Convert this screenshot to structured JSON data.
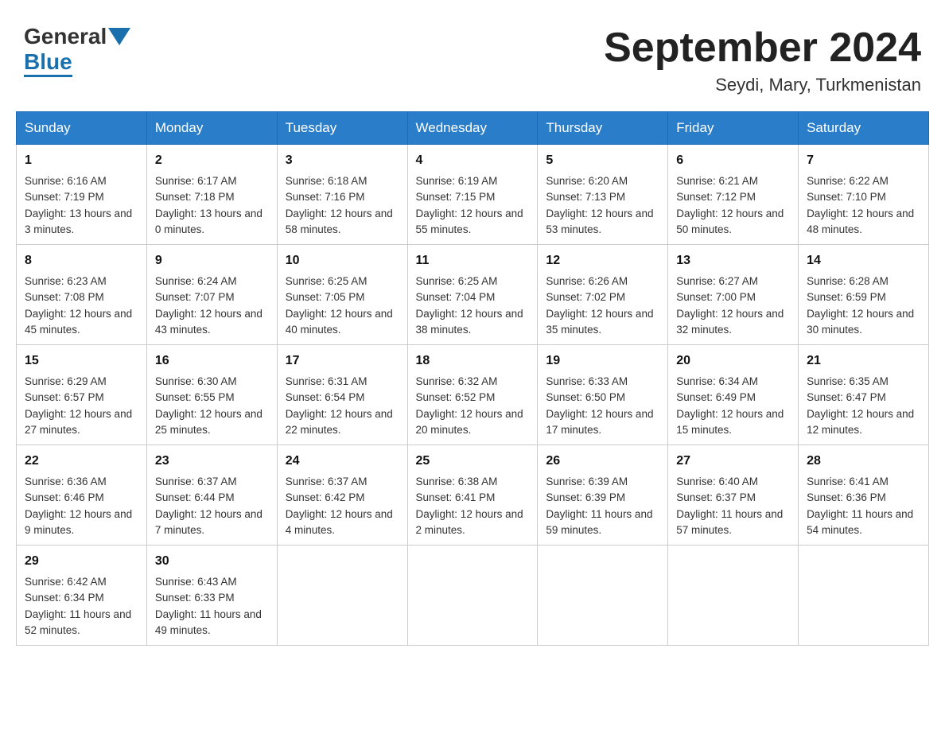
{
  "header": {
    "logo_text_general": "General",
    "logo_text_blue": "Blue",
    "title": "September 2024",
    "subtitle": "Seydi, Mary, Turkmenistan"
  },
  "weekdays": [
    "Sunday",
    "Monday",
    "Tuesday",
    "Wednesday",
    "Thursday",
    "Friday",
    "Saturday"
  ],
  "weeks": [
    [
      {
        "day": "1",
        "sunrise": "6:16 AM",
        "sunset": "7:19 PM",
        "daylight": "13 hours and 3 minutes."
      },
      {
        "day": "2",
        "sunrise": "6:17 AM",
        "sunset": "7:18 PM",
        "daylight": "13 hours and 0 minutes."
      },
      {
        "day": "3",
        "sunrise": "6:18 AM",
        "sunset": "7:16 PM",
        "daylight": "12 hours and 58 minutes."
      },
      {
        "day": "4",
        "sunrise": "6:19 AM",
        "sunset": "7:15 PM",
        "daylight": "12 hours and 55 minutes."
      },
      {
        "day": "5",
        "sunrise": "6:20 AM",
        "sunset": "7:13 PM",
        "daylight": "12 hours and 53 minutes."
      },
      {
        "day": "6",
        "sunrise": "6:21 AM",
        "sunset": "7:12 PM",
        "daylight": "12 hours and 50 minutes."
      },
      {
        "day": "7",
        "sunrise": "6:22 AM",
        "sunset": "7:10 PM",
        "daylight": "12 hours and 48 minutes."
      }
    ],
    [
      {
        "day": "8",
        "sunrise": "6:23 AM",
        "sunset": "7:08 PM",
        "daylight": "12 hours and 45 minutes."
      },
      {
        "day": "9",
        "sunrise": "6:24 AM",
        "sunset": "7:07 PM",
        "daylight": "12 hours and 43 minutes."
      },
      {
        "day": "10",
        "sunrise": "6:25 AM",
        "sunset": "7:05 PM",
        "daylight": "12 hours and 40 minutes."
      },
      {
        "day": "11",
        "sunrise": "6:25 AM",
        "sunset": "7:04 PM",
        "daylight": "12 hours and 38 minutes."
      },
      {
        "day": "12",
        "sunrise": "6:26 AM",
        "sunset": "7:02 PM",
        "daylight": "12 hours and 35 minutes."
      },
      {
        "day": "13",
        "sunrise": "6:27 AM",
        "sunset": "7:00 PM",
        "daylight": "12 hours and 32 minutes."
      },
      {
        "day": "14",
        "sunrise": "6:28 AM",
        "sunset": "6:59 PM",
        "daylight": "12 hours and 30 minutes."
      }
    ],
    [
      {
        "day": "15",
        "sunrise": "6:29 AM",
        "sunset": "6:57 PM",
        "daylight": "12 hours and 27 minutes."
      },
      {
        "day": "16",
        "sunrise": "6:30 AM",
        "sunset": "6:55 PM",
        "daylight": "12 hours and 25 minutes."
      },
      {
        "day": "17",
        "sunrise": "6:31 AM",
        "sunset": "6:54 PM",
        "daylight": "12 hours and 22 minutes."
      },
      {
        "day": "18",
        "sunrise": "6:32 AM",
        "sunset": "6:52 PM",
        "daylight": "12 hours and 20 minutes."
      },
      {
        "day": "19",
        "sunrise": "6:33 AM",
        "sunset": "6:50 PM",
        "daylight": "12 hours and 17 minutes."
      },
      {
        "day": "20",
        "sunrise": "6:34 AM",
        "sunset": "6:49 PM",
        "daylight": "12 hours and 15 minutes."
      },
      {
        "day": "21",
        "sunrise": "6:35 AM",
        "sunset": "6:47 PM",
        "daylight": "12 hours and 12 minutes."
      }
    ],
    [
      {
        "day": "22",
        "sunrise": "6:36 AM",
        "sunset": "6:46 PM",
        "daylight": "12 hours and 9 minutes."
      },
      {
        "day": "23",
        "sunrise": "6:37 AM",
        "sunset": "6:44 PM",
        "daylight": "12 hours and 7 minutes."
      },
      {
        "day": "24",
        "sunrise": "6:37 AM",
        "sunset": "6:42 PM",
        "daylight": "12 hours and 4 minutes."
      },
      {
        "day": "25",
        "sunrise": "6:38 AM",
        "sunset": "6:41 PM",
        "daylight": "12 hours and 2 minutes."
      },
      {
        "day": "26",
        "sunrise": "6:39 AM",
        "sunset": "6:39 PM",
        "daylight": "11 hours and 59 minutes."
      },
      {
        "day": "27",
        "sunrise": "6:40 AM",
        "sunset": "6:37 PM",
        "daylight": "11 hours and 57 minutes."
      },
      {
        "day": "28",
        "sunrise": "6:41 AM",
        "sunset": "6:36 PM",
        "daylight": "11 hours and 54 minutes."
      }
    ],
    [
      {
        "day": "29",
        "sunrise": "6:42 AM",
        "sunset": "6:34 PM",
        "daylight": "11 hours and 52 minutes."
      },
      {
        "day": "30",
        "sunrise": "6:43 AM",
        "sunset": "6:33 PM",
        "daylight": "11 hours and 49 minutes."
      },
      null,
      null,
      null,
      null,
      null
    ]
  ]
}
